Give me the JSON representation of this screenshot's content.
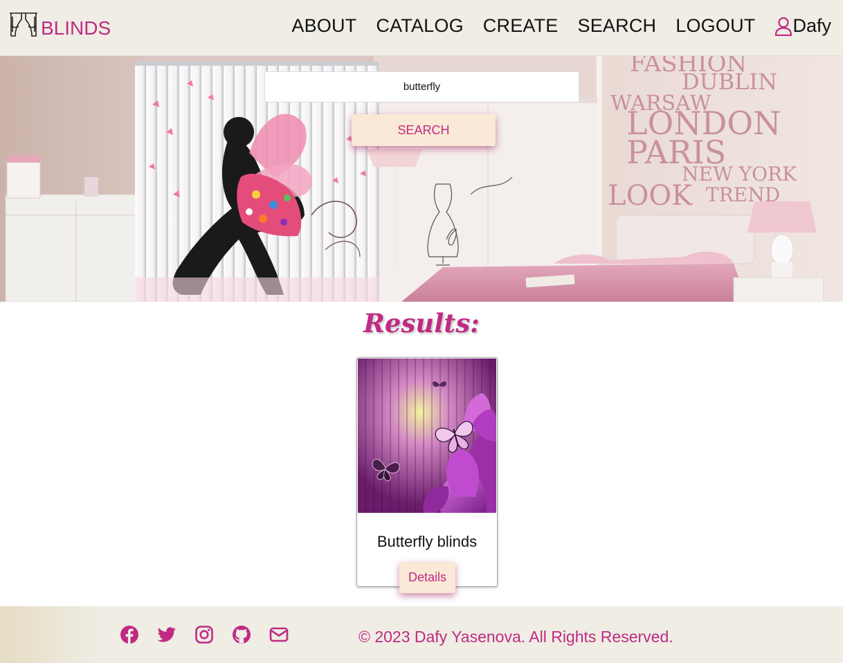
{
  "header": {
    "logo_text": "BLINDS",
    "nav": {
      "about": "ABOUT",
      "catalog": "CATALOG",
      "create": "CREATE",
      "search": "SEARCH",
      "logout": "LOGOUT"
    },
    "user_name": "Dafy"
  },
  "hero": {
    "search_value": "butterfly",
    "search_button": "SEARCH",
    "wall_words": [
      "FASHION",
      "DUBLIN",
      "WARSAW",
      "LONDON",
      "PARIS",
      "NEW YORK",
      "LOOK",
      "TREND"
    ]
  },
  "results": {
    "title": "Results:",
    "items": [
      {
        "title": "Butterfly blinds",
        "button": "Details"
      }
    ]
  },
  "footer": {
    "social": [
      "facebook-icon",
      "twitter-icon",
      "instagram-icon",
      "github-icon",
      "envelope-icon"
    ],
    "copyright": "© 2023 Dafy Yasenova. All Rights Reserved."
  },
  "colors": {
    "accent": "#c02a83",
    "header_bg": "#efede4",
    "button_bg": "#f9e9d6"
  }
}
